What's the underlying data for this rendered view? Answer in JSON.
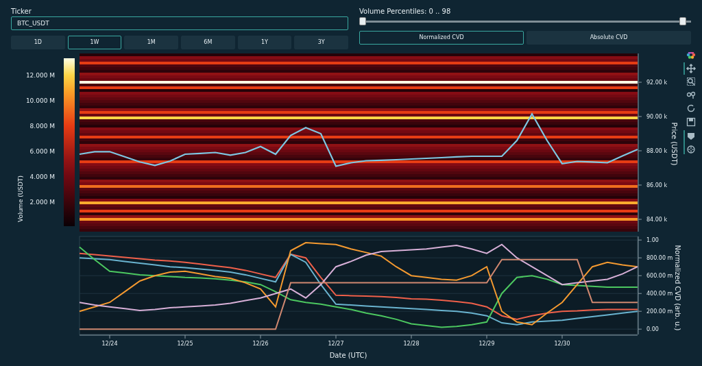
{
  "ticker": {
    "label": "Ticker",
    "value": "BTC_USDT"
  },
  "periods": [
    {
      "label": "1D",
      "selected": false
    },
    {
      "label": "1W",
      "selected": true
    },
    {
      "label": "1M",
      "selected": false
    },
    {
      "label": "6M",
      "selected": false
    },
    {
      "label": "1Y",
      "selected": false
    },
    {
      "label": "3Y",
      "selected": false
    }
  ],
  "volume_slider": {
    "label": "Volume Percentiles: 0 .. 98",
    "thumbs": [
      {
        "level": 0
      },
      {
        "level": 0.985
      }
    ]
  },
  "cvd_modes": [
    {
      "label": "Normalized CVD",
      "selected": true
    },
    {
      "label": "Absolute CVD",
      "selected": false
    }
  ],
  "colorbar": {
    "title": "Volume (USDT)",
    "tick_labels": [
      "12.000 M",
      "10.000 M",
      "8.000 M",
      "6.000 M",
      "4.000 M",
      "2.000 M"
    ]
  },
  "price_chart": {
    "chart_data": {
      "type": "line",
      "ylabel": "Price (USDT)",
      "ylim": [
        83280,
        93680
      ],
      "yticks": [
        {
          "value": 84000,
          "label": "84.00 k"
        },
        {
          "value": 86000,
          "label": "86.00 k"
        },
        {
          "value": 88000,
          "label": "88.00 k"
        },
        {
          "value": 90000,
          "label": "90.00 k"
        },
        {
          "value": 92000,
          "label": "92.00 k"
        }
      ],
      "categories": [
        null,
        null,
        null,
        null,
        null,
        null,
        null,
        null,
        null,
        null,
        null,
        null,
        null,
        null,
        null,
        null,
        null,
        null,
        null,
        null,
        null,
        null,
        null,
        null,
        null,
        null,
        null,
        null,
        null,
        null,
        null,
        null,
        null,
        null,
        null,
        null,
        null,
        null
      ],
      "series": [
        {
          "color": "#7ec8e3",
          "values": [
            87800,
            87950,
            87950,
            87650,
            87350,
            87150,
            87400,
            87800,
            87850,
            87900,
            87750,
            87900,
            88250,
            87800,
            88900,
            89350,
            89000,
            87100,
            87300,
            87420,
            87450,
            87480,
            87520,
            87560,
            87600,
            87650,
            87680,
            87680,
            87680,
            88600,
            90150,
            88600,
            87250,
            87380,
            87350,
            87300,
            87700,
            88080
          ]
        }
      ]
    }
  },
  "cvd_chart": {
    "chart_data": {
      "type": "line",
      "grid": true,
      "xlabel": "Date (UTC)",
      "ylabel": "Normalized CVD (arb. u.)",
      "ylim": [
        -60,
        1040
      ],
      "categories": [
        null,
        null,
        "12/24",
        null,
        null,
        null,
        null,
        "12/25",
        null,
        null,
        null,
        null,
        "12/26",
        null,
        null,
        null,
        null,
        "12/27",
        null,
        null,
        null,
        null,
        "12/28",
        null,
        null,
        null,
        null,
        "12/29",
        null,
        null,
        null,
        null,
        "12/30",
        null,
        null,
        null,
        null,
        null
      ],
      "yticks": [
        {
          "value": 0,
          "label": "0.00"
        },
        {
          "value": 200,
          "label": "200.00 m"
        },
        {
          "value": 400,
          "label": "400.00 m"
        },
        {
          "value": 600,
          "label": "600.00 m"
        },
        {
          "value": 800,
          "label": "800.00 m"
        }
      ],
      "series": [
        {
          "color": "#f0604a",
          "values": [
            850,
            835,
            820,
            805,
            790,
            775,
            765,
            750,
            730,
            710,
            690,
            660,
            620,
            580,
            840,
            800,
            580,
            380,
            375,
            370,
            365,
            355,
            340,
            335,
            325,
            310,
            290,
            250,
            150,
            110,
            150,
            180,
            200,
            205,
            215,
            220,
            220,
            220
          ]
        },
        {
          "color": "#6ab4d0",
          "values": [
            800,
            790,
            780,
            760,
            740,
            720,
            700,
            690,
            675,
            660,
            640,
            610,
            570,
            530,
            840,
            750,
            500,
            280,
            270,
            260,
            250,
            240,
            230,
            220,
            210,
            200,
            180,
            150,
            70,
            50,
            80,
            90,
            100,
            120,
            140,
            160,
            180,
            200
          ]
        },
        {
          "color": "#4cc860",
          "values": [
            920,
            780,
            650,
            630,
            610,
            600,
            590,
            580,
            575,
            565,
            550,
            530,
            500,
            420,
            330,
            300,
            280,
            250,
            220,
            180,
            150,
            110,
            60,
            40,
            20,
            30,
            50,
            80,
            400,
            580,
            600,
            560,
            500,
            490,
            480,
            470,
            470,
            470
          ]
        },
        {
          "color": "#f59a30",
          "values": [
            200,
            250,
            300,
            420,
            540,
            600,
            640,
            650,
            620,
            590,
            570,
            520,
            450,
            250,
            880,
            970,
            960,
            950,
            900,
            860,
            820,
            700,
            600,
            580,
            560,
            550,
            600,
            700,
            200,
            80,
            50,
            180,
            300,
            500,
            700,
            750,
            720,
            700
          ]
        },
        {
          "color": "#d8b0d8",
          "values": [
            300,
            270,
            250,
            230,
            210,
            220,
            240,
            250,
            260,
            270,
            290,
            320,
            350,
            400,
            450,
            350,
            500,
            700,
            760,
            830,
            870,
            880,
            890,
            900,
            920,
            940,
            900,
            850,
            950,
            800,
            700,
            600,
            500,
            520,
            540,
            560,
            620,
            700
          ]
        },
        {
          "color": "#d08870",
          "values": [
            0,
            0,
            0,
            0,
            0,
            0,
            0,
            0,
            0,
            0,
            0,
            0,
            0,
            0,
            520,
            520,
            520,
            520,
            520,
            520,
            520,
            520,
            520,
            520,
            520,
            520,
            520,
            520,
            780,
            780,
            780,
            780,
            780,
            780,
            300,
            300,
            300,
            300
          ]
        }
      ]
    },
    "top_tick_label": "1.00"
  }
}
